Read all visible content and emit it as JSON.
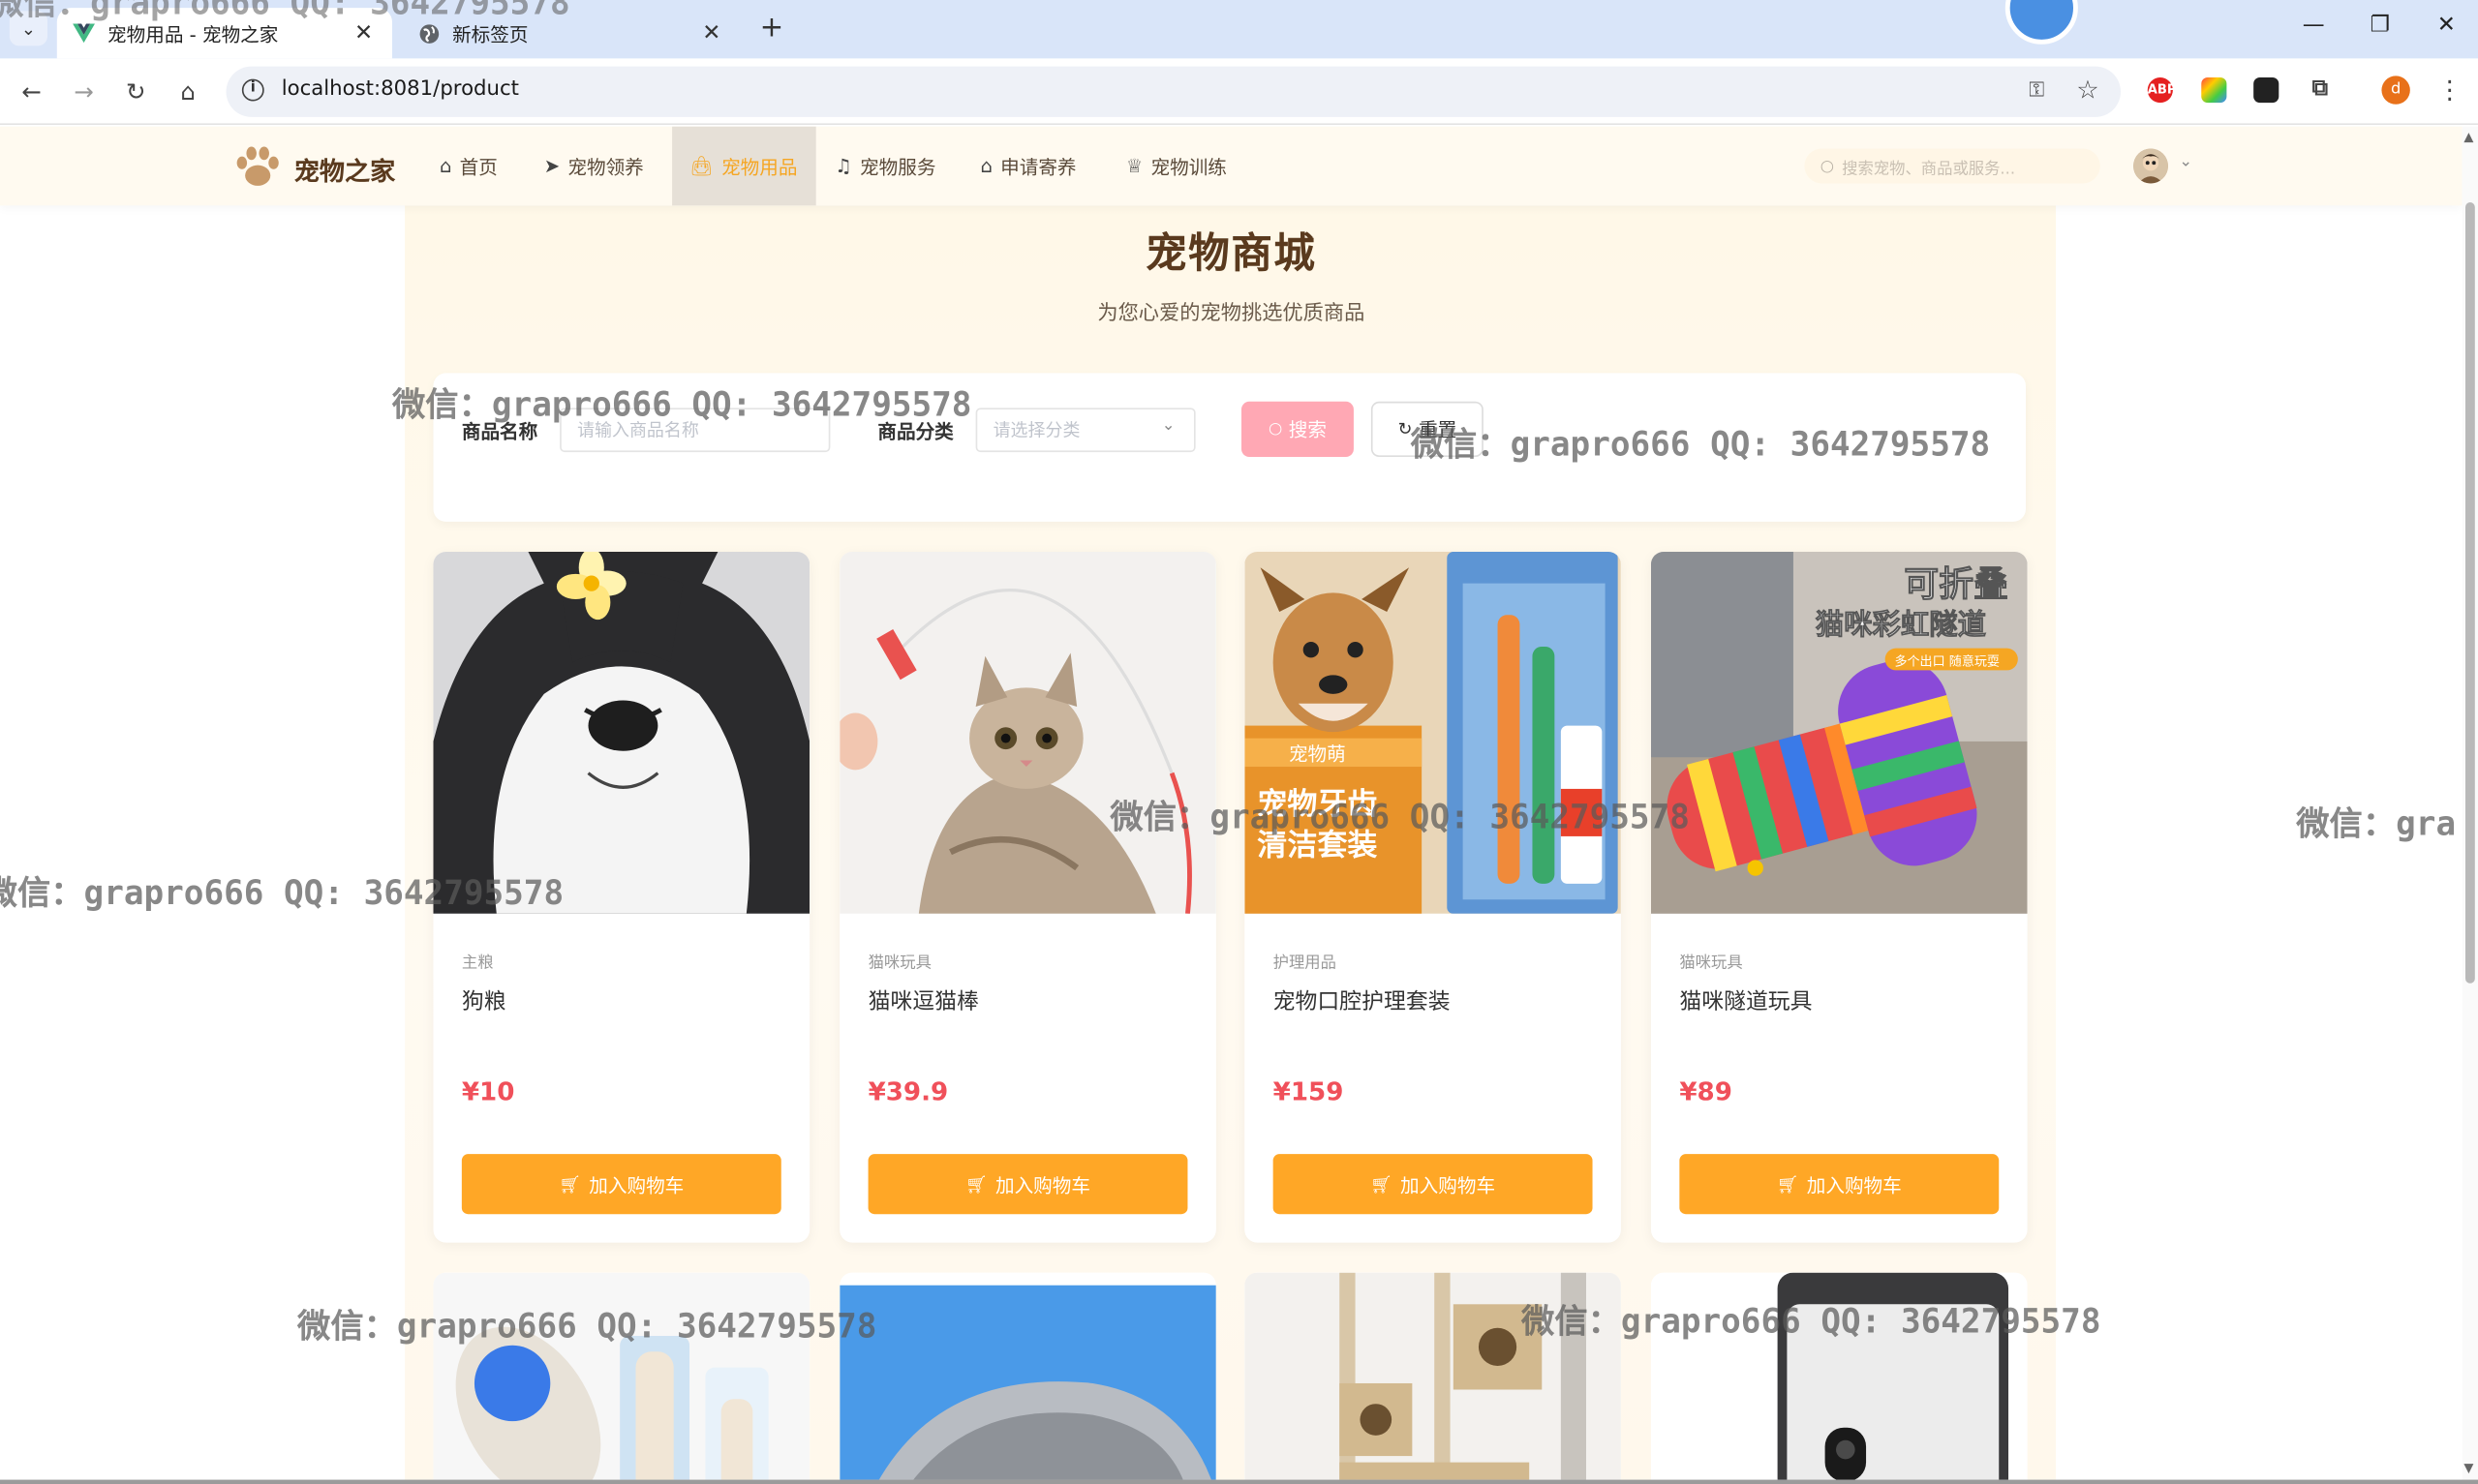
{
  "browser": {
    "tabs": [
      {
        "title": "宠物用品 - 宠物之家",
        "active": true,
        "favicon": "vue-logo-icon"
      },
      {
        "title": "新标签页",
        "active": false,
        "favicon": "globe-icon"
      }
    ],
    "url": "localhost:8081/product",
    "profile_initial": "d",
    "extensions": [
      "ABP",
      "colorpicker",
      "bookmarks",
      "puzzle"
    ]
  },
  "site": {
    "brand": "宠物之家",
    "nav": [
      {
        "label": "首页",
        "icon": "home-icon",
        "active": false
      },
      {
        "label": "宠物领养",
        "icon": "send-icon",
        "active": false
      },
      {
        "label": "宠物用品",
        "icon": "bag-icon",
        "active": true
      },
      {
        "label": "宠物服务",
        "icon": "headset-icon",
        "active": false
      },
      {
        "label": "申请寄养",
        "icon": "house-icon",
        "active": false
      },
      {
        "label": "宠物训练",
        "icon": "trophy-icon",
        "active": false
      }
    ],
    "search_placeholder": "搜索宠物、商品或服务..."
  },
  "page": {
    "title": "宠物商城",
    "subtitle": "为您心爱的宠物挑选优质商品"
  },
  "filters": {
    "name_label": "商品名称",
    "name_placeholder": "请输入商品名称",
    "category_label": "商品分类",
    "category_placeholder": "请选择分类",
    "search_label": "搜索",
    "reset_label": "重置"
  },
  "products": [
    {
      "category": "主粮",
      "name": "狗粮",
      "price": "¥10",
      "cart_label": "加入购物车"
    },
    {
      "category": "猫咪玩具",
      "name": "猫咪逗猫棒",
      "price": "¥39.9",
      "cart_label": "加入购物车"
    },
    {
      "category": "护理用品",
      "name": "宠物口腔护理套装",
      "price": "¥159",
      "cart_label": "加入购物车"
    },
    {
      "category": "猫咪玩具",
      "name": "猫咪隧道玩具",
      "price": "¥89",
      "cart_label": "加入购物车"
    }
  ],
  "image_text": {
    "tunnel_line1": "可折叠",
    "tunnel_line2": "猫咪彩虹隧道",
    "tunnel_line3": "多个出口 随意玩耍",
    "dental_brand": "宠物萌",
    "dental_line1": "宠物牙齿",
    "dental_line2": "清洁套装"
  },
  "watermark": "微信：grapro666 QQ: 3642795578",
  "watermark_partial": "微信：gra",
  "colors": {
    "accent": "#ffa726",
    "price": "#f0505a",
    "brand_text": "#5a3a1e",
    "active_nav": "#f5a623",
    "search_btn": "#ffa8b4"
  }
}
